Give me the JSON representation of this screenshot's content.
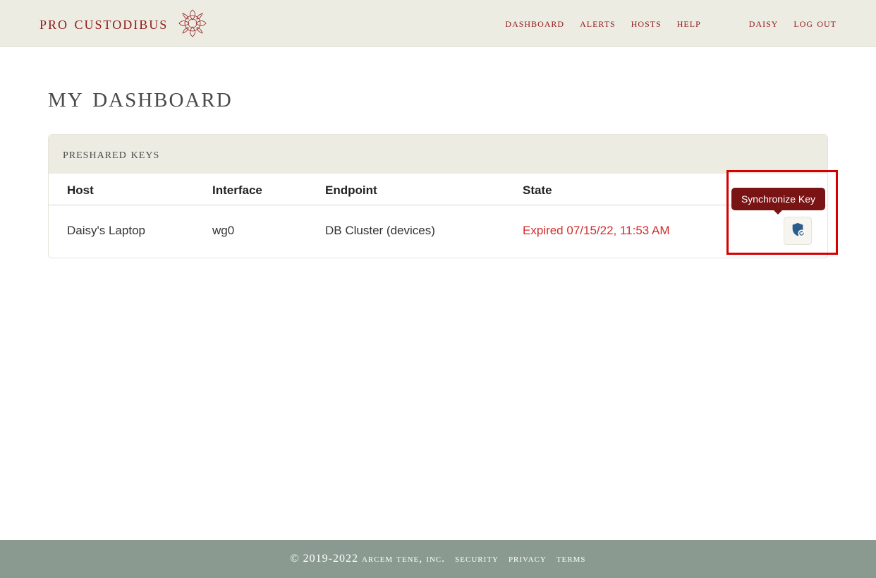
{
  "brand": {
    "name": "pro custodibus"
  },
  "nav": {
    "dashboard": "dashboard",
    "alerts": "alerts",
    "hosts": "hosts",
    "help": "help",
    "user": "daisy",
    "logout": "log out"
  },
  "page": {
    "title": "my dashboard"
  },
  "panel": {
    "title": "preshared keys",
    "columns": {
      "host": "Host",
      "interface": "Interface",
      "endpoint": "Endpoint",
      "state": "State"
    },
    "rows": [
      {
        "host": "Daisy's Laptop",
        "interface": "wg0",
        "endpoint": "DB Cluster (devices)",
        "state": "Expired 07/15/22, 11:53 AM"
      }
    ],
    "tooltip": "Synchronize Key"
  },
  "footer": {
    "copyright": "© 2019-2022 arcem tene, inc.",
    "security": "security",
    "privacy": "privacy",
    "terms": "terms"
  }
}
